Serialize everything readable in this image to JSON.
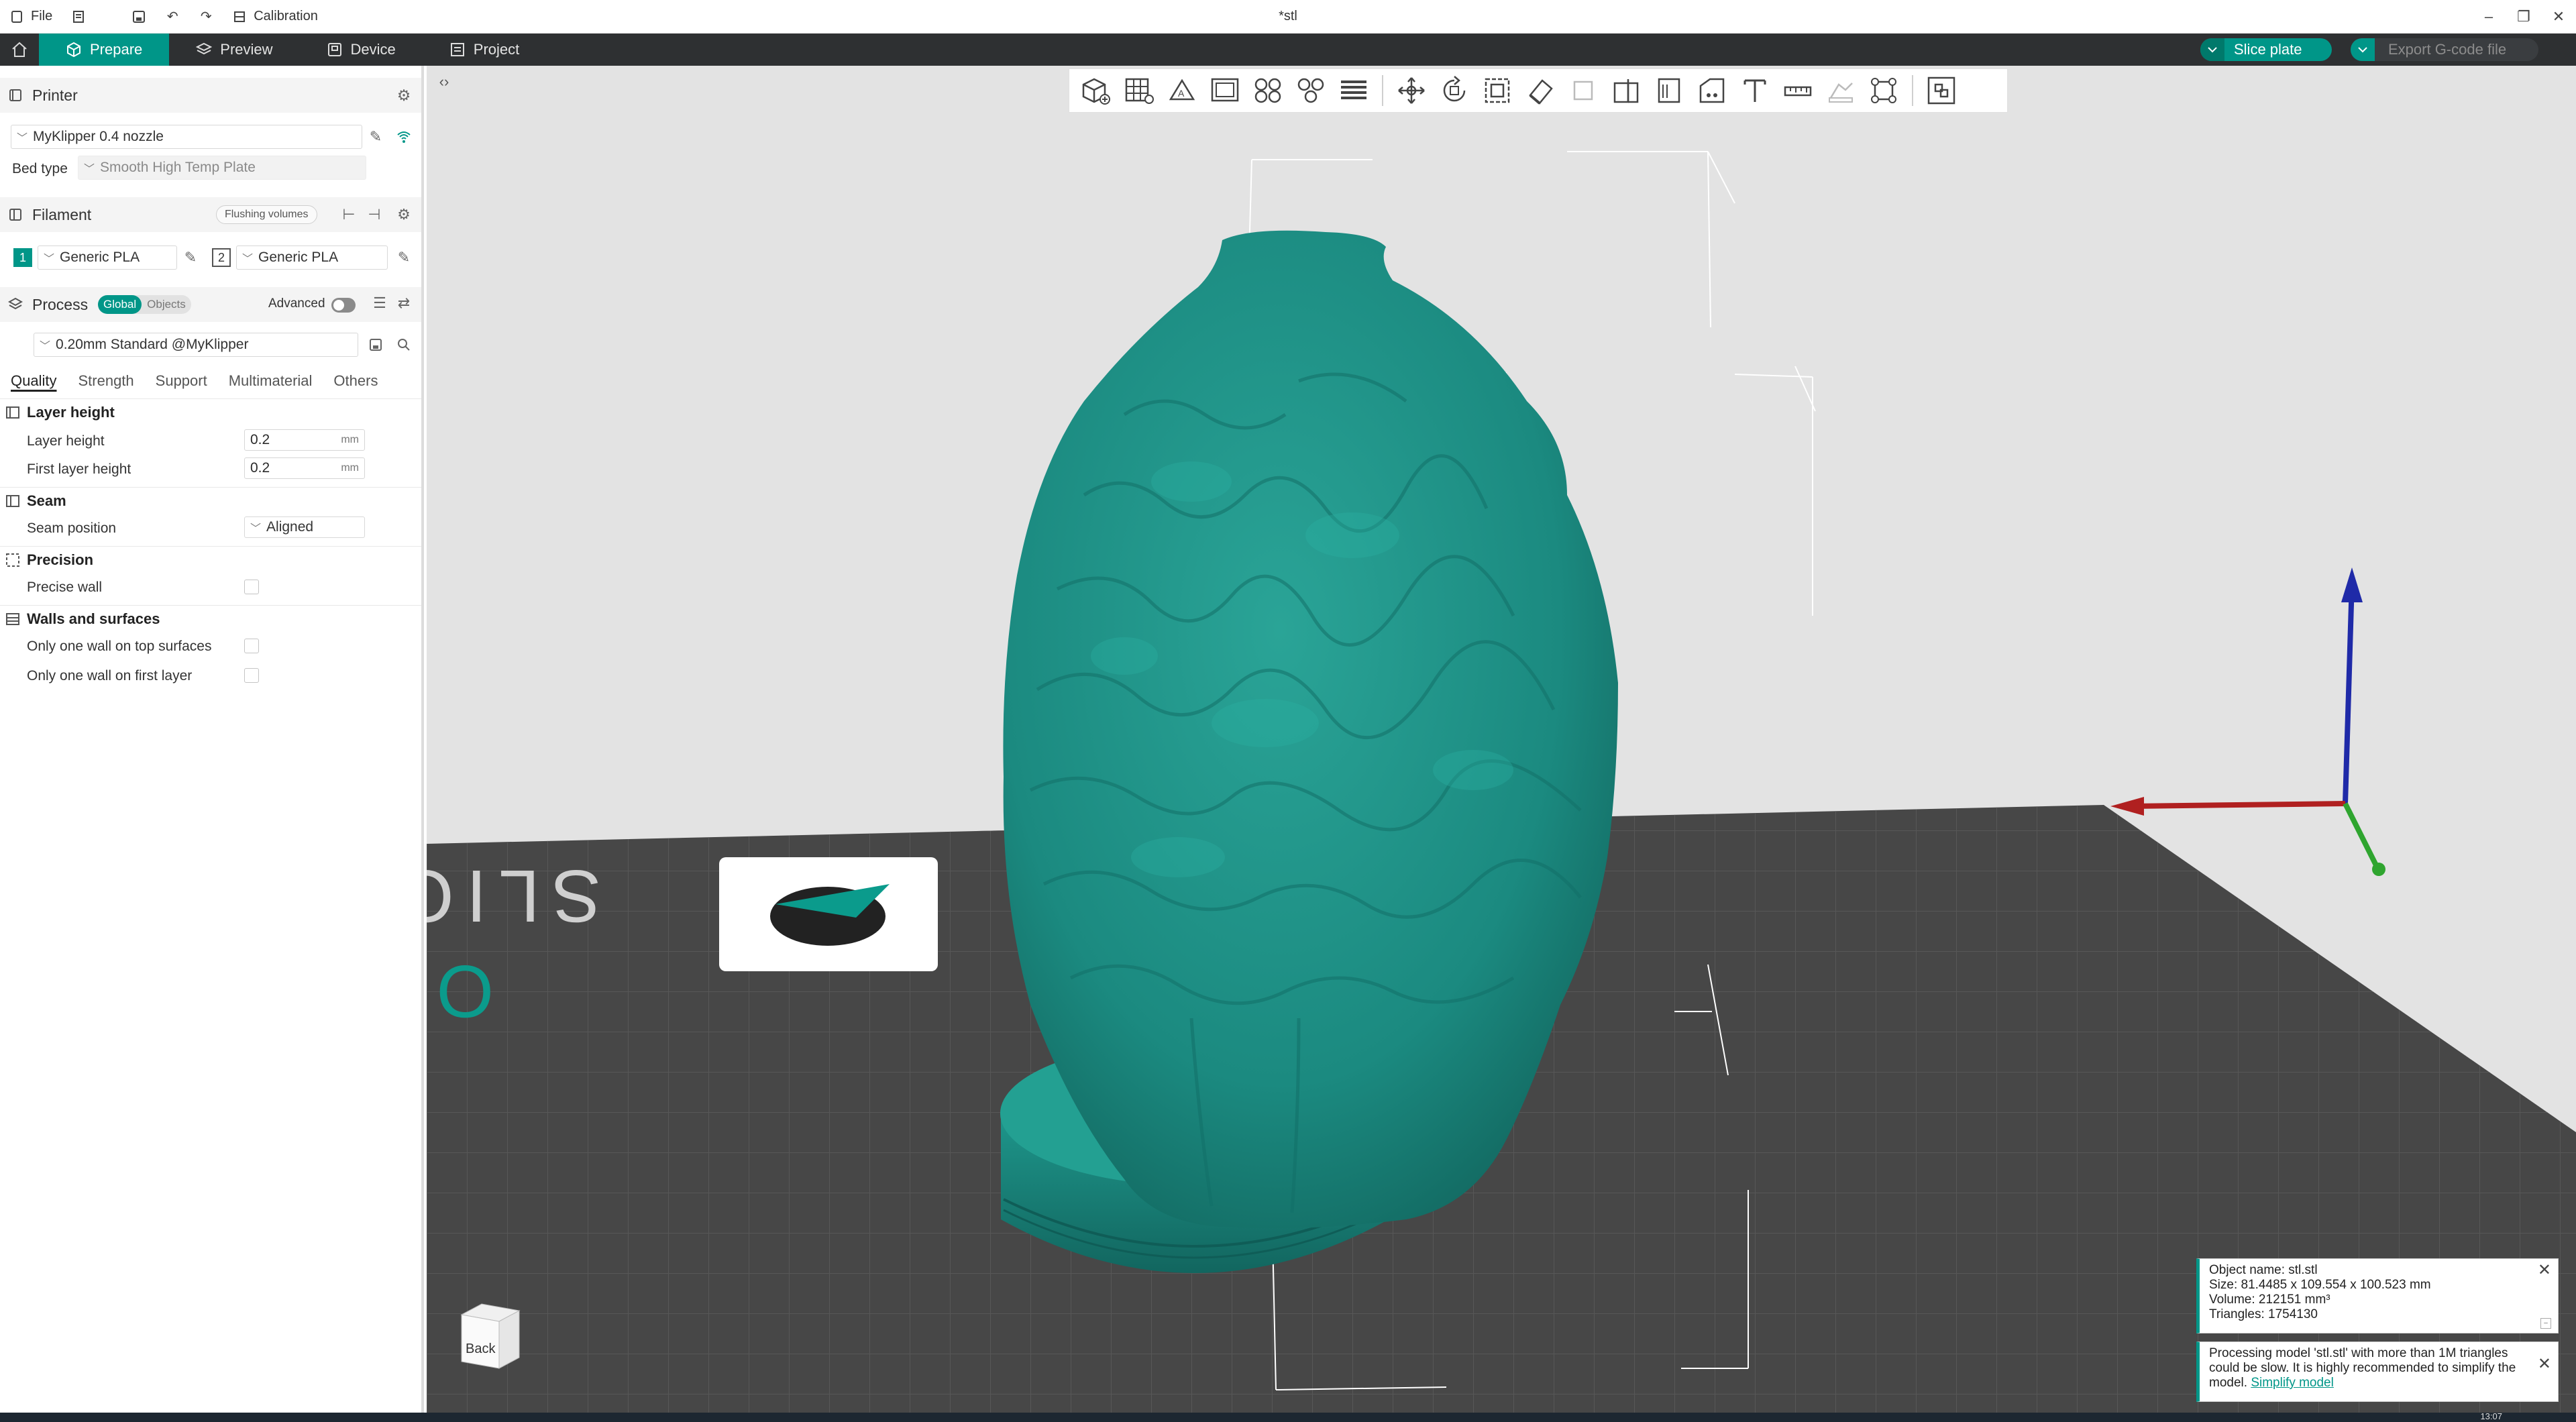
{
  "titlebar": {
    "file_label": "File",
    "calibration_label": "Calibration",
    "window_title": "*stl"
  },
  "tabs": [
    {
      "label": "Prepare",
      "active": true
    },
    {
      "label": "Preview",
      "active": false
    },
    {
      "label": "Device",
      "active": false
    },
    {
      "label": "Project",
      "active": false
    }
  ],
  "actions": {
    "slice_label": "Slice plate",
    "export_label": "Export G-code file"
  },
  "printer": {
    "section_label": "Printer",
    "preset": "MyKlipper 0.4 nozzle",
    "bed_type_label": "Bed type",
    "bed_type_value": "Smooth High Temp Plate"
  },
  "filament": {
    "section_label": "Filament",
    "flushing_label": "Flushing volumes",
    "slots": [
      {
        "num": "1",
        "name": "Generic PLA"
      },
      {
        "num": "2",
        "name": "Generic PLA"
      }
    ]
  },
  "process": {
    "section_label": "Process",
    "global_label": "Global",
    "objects_label": "Objects",
    "advanced_label": "Advanced",
    "preset": "0.20mm Standard @MyKlipper",
    "tabs": [
      "Quality",
      "Strength",
      "Support",
      "Multimaterial",
      "Others"
    ]
  },
  "quality": {
    "layer_height_group": "Layer height",
    "layer_height_label": "Layer height",
    "layer_height_value": "0.2",
    "first_layer_label": "First layer height",
    "first_layer_value": "0.2",
    "unit": "mm",
    "seam_group": "Seam",
    "seam_position_label": "Seam position",
    "seam_position_value": "Aligned",
    "precision_group": "Precision",
    "precise_wall_label": "Precise wall",
    "walls_group": "Walls and surfaces",
    "one_wall_top_label": "Only one wall on top surfaces",
    "one_wall_first_label": "Only one wall on first layer"
  },
  "viewport": {
    "back_label": "Back",
    "plate_logo_text": "ORCA SLICER"
  },
  "notifications": {
    "object_name": "Object name: stl.stl",
    "size": "Size: 81.4485 x 109.554 x 100.523 mm",
    "volume": "Volume: 212151 mm³",
    "triangles": "Triangles: 1754130",
    "processing_text": "Processing model 'stl.stl' with more than 1M triangles could be slow. It is highly recommended to simplify the model.",
    "simplify_link": "Simplify model"
  },
  "taskbar": {
    "clock": "13:07"
  },
  "colors": {
    "accent": "#009688",
    "model": "#1f8f86",
    "plate": "#4a4a4a",
    "background": "#e3e3e3"
  }
}
